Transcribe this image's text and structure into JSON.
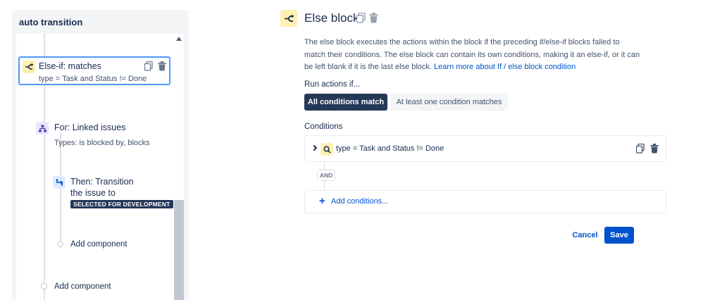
{
  "sidebar": {
    "title": "auto transition",
    "else_if": {
      "title": "Else-if: matches",
      "subtitle": "type = Task and Status != Done"
    },
    "for_node": {
      "title": "For: Linked issues",
      "subtitle": "Types: is blocked by, blocks"
    },
    "then_node": {
      "title_line1": "Then: Transition",
      "title_line2": "the issue to",
      "status": "SELECTED FOR DEVELOPMENT"
    },
    "add_component_inner": "Add component",
    "add_component_outer": "Add component"
  },
  "config": {
    "title": "Else block",
    "description": "The else block executes the actions within the block if the preceding if/else-if blocks failed to match their conditions. The else block can contain its own conditions, making it an else-if, or it can be left blank if it is the last else block.",
    "learn_more": "Learn more about If / else block condition",
    "run_label": "Run actions if...",
    "run_options": [
      "All conditions match",
      "At least one condition matches"
    ],
    "conditions_label": "Conditions",
    "condition_text": "type = Task and Status != Done",
    "and_label": "AND",
    "add_conditions": "Add conditions...",
    "cancel": "Cancel",
    "save": "Save"
  },
  "colors": {
    "accent": "#0052cc",
    "selected_border": "#4c9aff",
    "branch_icon_bg": "#fff0b3",
    "dark_button": "#253858"
  }
}
